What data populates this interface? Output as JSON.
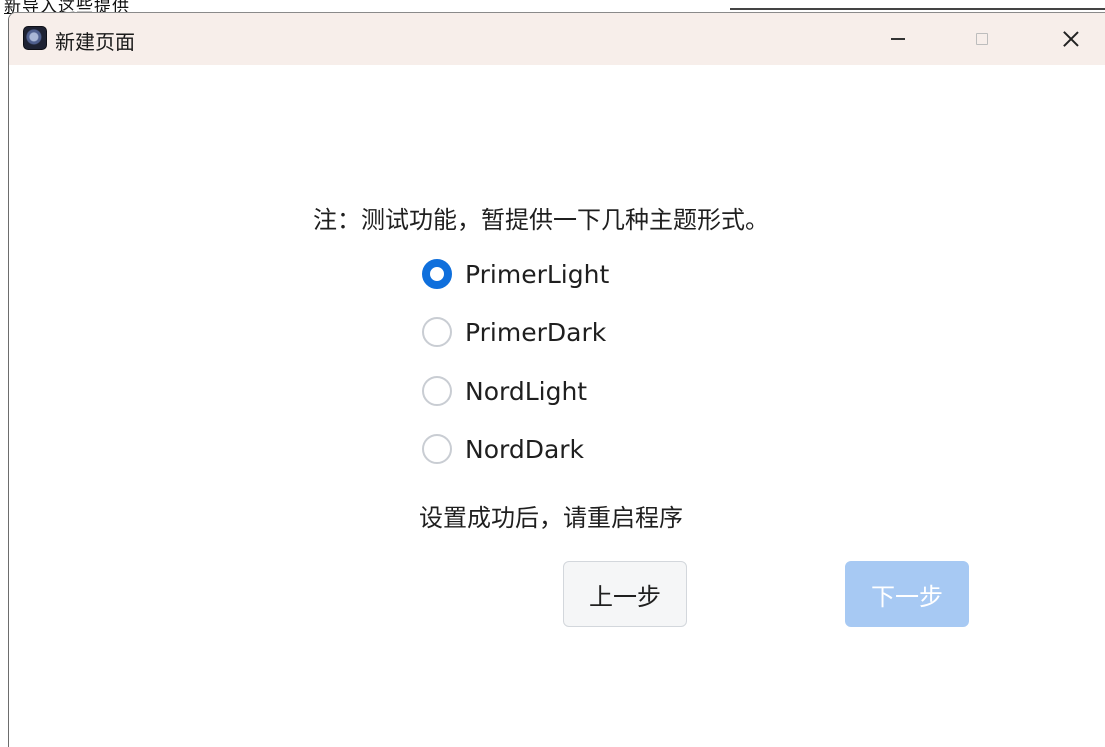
{
  "background": {
    "text": "新导入这些提供"
  },
  "window": {
    "title": "新建页面",
    "controls": {
      "minimize": "minimize",
      "maximize": "maximize",
      "close": "close"
    }
  },
  "content": {
    "notice": "注：测试功能，暂提供一下几种主题形式。",
    "themes": [
      {
        "label": "PrimerLight",
        "checked": true
      },
      {
        "label": "PrimerDark",
        "checked": false
      },
      {
        "label": "NordLight",
        "checked": false
      },
      {
        "label": "NordDark",
        "checked": false
      }
    ],
    "hint": "设置成功后，请重启程序",
    "buttons": {
      "prev": "上一步",
      "next": "下一步",
      "next_enabled": false
    }
  },
  "colors": {
    "accent": "#0f6fdc",
    "titlebar": "#f7eeea",
    "next_button_disabled": "#a7c9f3"
  }
}
